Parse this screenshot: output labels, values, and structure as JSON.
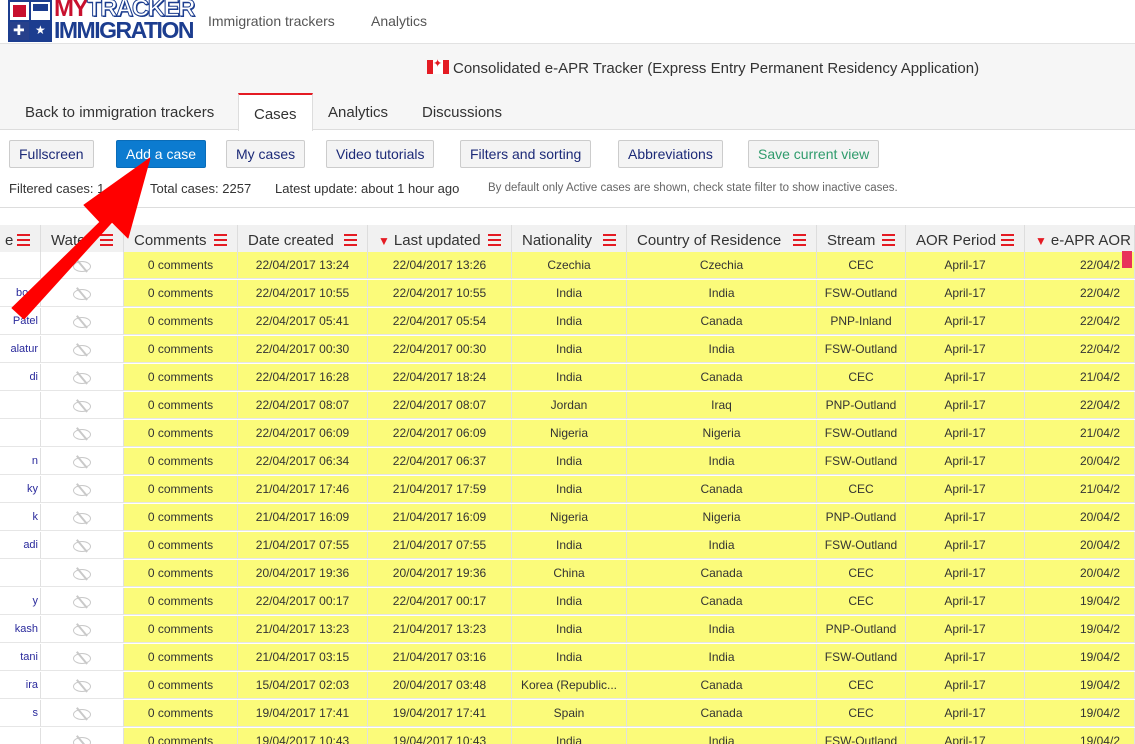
{
  "logo": {
    "line1a": "MY",
    "line1b": "TRACKER",
    "line2": "IMMIGRATION"
  },
  "topnav": {
    "link1": "Immigration trackers",
    "link2": "Analytics"
  },
  "tracker_title": "Consolidated e-APR Tracker (Express Entry Permanent Residency Application)",
  "tabs": [
    "Back to immigration trackers",
    "Cases",
    "Analytics",
    "Discussions"
  ],
  "toolbar": {
    "fullscreen": "Fullscreen",
    "add_case": "Add a case",
    "my_cases": "My cases",
    "video_tutorials": "Video tutorials",
    "filters": "Filters and sorting",
    "abbreviations": "Abbreviations",
    "save_view": "Save current view"
  },
  "stats": {
    "filtered": "Filtered cases: 1",
    "total": "Total cases: 2257",
    "updated": "Latest update: about 1 hour ago",
    "note": "By default only Active cases are shown, check state filter to show inactive cases."
  },
  "colors": {
    "accent": "#e41b23",
    "primary_button": "#0c7bd0",
    "row_highlight": "#fbfb7a"
  },
  "table": {
    "headers": [
      "e",
      "Wate",
      "Comments",
      "Date created",
      "Last updated",
      "Nationality",
      "Country of Residence",
      "Stream",
      "AOR Period",
      "e-APR AOR"
    ],
    "rows": [
      {
        "name": "",
        "comments": "0 comments",
        "created": "22/04/2017 13:24",
        "updated": "22/04/2017 13:26",
        "nationality": "Czechia",
        "residence": "Czechia",
        "stream": "CEC",
        "aor_period": "April-17",
        "aor": "22/04/2"
      },
      {
        "name": "boor",
        "comments": "0 comments",
        "created": "22/04/2017 10:55",
        "updated": "22/04/2017 10:55",
        "nationality": "India",
        "residence": "India",
        "stream": "FSW-Outland",
        "aor_period": "April-17",
        "aor": "22/04/2"
      },
      {
        "name": "Patel",
        "comments": "0 comments",
        "created": "22/04/2017 05:41",
        "updated": "22/04/2017 05:54",
        "nationality": "India",
        "residence": "Canada",
        "stream": "PNP-Inland",
        "aor_period": "April-17",
        "aor": "22/04/2"
      },
      {
        "name": "alatur",
        "comments": "0 comments",
        "created": "22/04/2017 00:30",
        "updated": "22/04/2017 00:30",
        "nationality": "India",
        "residence": "India",
        "stream": "FSW-Outland",
        "aor_period": "April-17",
        "aor": "22/04/2"
      },
      {
        "name": "di",
        "comments": "0 comments",
        "created": "22/04/2017 16:28",
        "updated": "22/04/2017 18:24",
        "nationality": "India",
        "residence": "Canada",
        "stream": "CEC",
        "aor_period": "April-17",
        "aor": "21/04/2"
      },
      {
        "name": "",
        "comments": "0 comments",
        "created": "22/04/2017 08:07",
        "updated": "22/04/2017 08:07",
        "nationality": "Jordan",
        "residence": "Iraq",
        "stream": "PNP-Outland",
        "aor_period": "April-17",
        "aor": "22/04/2"
      },
      {
        "name": "",
        "comments": "0 comments",
        "created": "22/04/2017 06:09",
        "updated": "22/04/2017 06:09",
        "nationality": "Nigeria",
        "residence": "Nigeria",
        "stream": "FSW-Outland",
        "aor_period": "April-17",
        "aor": "21/04/2"
      },
      {
        "name": "n",
        "comments": "0 comments",
        "created": "22/04/2017 06:34",
        "updated": "22/04/2017 06:37",
        "nationality": "India",
        "residence": "India",
        "stream": "FSW-Outland",
        "aor_period": "April-17",
        "aor": "20/04/2"
      },
      {
        "name": "ky",
        "comments": "0 comments",
        "created": "21/04/2017 17:46",
        "updated": "21/04/2017 17:59",
        "nationality": "India",
        "residence": "Canada",
        "stream": "CEC",
        "aor_period": "April-17",
        "aor": "21/04/2"
      },
      {
        "name": "k",
        "comments": "0 comments",
        "created": "21/04/2017 16:09",
        "updated": "21/04/2017 16:09",
        "nationality": "Nigeria",
        "residence": "Nigeria",
        "stream": "PNP-Outland",
        "aor_period": "April-17",
        "aor": "20/04/2"
      },
      {
        "name": "adi",
        "comments": "0 comments",
        "created": "21/04/2017 07:55",
        "updated": "21/04/2017 07:55",
        "nationality": "India",
        "residence": "India",
        "stream": "FSW-Outland",
        "aor_period": "April-17",
        "aor": "20/04/2"
      },
      {
        "name": "",
        "comments": "0 comments",
        "created": "20/04/2017 19:36",
        "updated": "20/04/2017 19:36",
        "nationality": "China",
        "residence": "Canada",
        "stream": "CEC",
        "aor_period": "April-17",
        "aor": "20/04/2"
      },
      {
        "name": "y",
        "comments": "0 comments",
        "created": "22/04/2017 00:17",
        "updated": "22/04/2017 00:17",
        "nationality": "India",
        "residence": "Canada",
        "stream": "CEC",
        "aor_period": "April-17",
        "aor": "19/04/2"
      },
      {
        "name": "kash",
        "comments": "0 comments",
        "created": "21/04/2017 13:23",
        "updated": "21/04/2017 13:23",
        "nationality": "India",
        "residence": "India",
        "stream": "PNP-Outland",
        "aor_period": "April-17",
        "aor": "19/04/2"
      },
      {
        "name": "tani",
        "comments": "0 comments",
        "created": "21/04/2017 03:15",
        "updated": "21/04/2017 03:16",
        "nationality": "India",
        "residence": "India",
        "stream": "FSW-Outland",
        "aor_period": "April-17",
        "aor": "19/04/2"
      },
      {
        "name": "ira",
        "comments": "0 comments",
        "created": "15/04/2017 02:03",
        "updated": "20/04/2017 03:48",
        "nationality": "Korea (Republic...",
        "residence": "Canada",
        "stream": "CEC",
        "aor_period": "April-17",
        "aor": "19/04/2"
      },
      {
        "name": "s",
        "comments": "0 comments",
        "created": "19/04/2017 17:41",
        "updated": "19/04/2017 17:41",
        "nationality": "Spain",
        "residence": "Canada",
        "stream": "CEC",
        "aor_period": "April-17",
        "aor": "19/04/2"
      },
      {
        "name": "",
        "comments": "0 comments",
        "created": "19/04/2017 10:43",
        "updated": "19/04/2017 10:43",
        "nationality": "India",
        "residence": "India",
        "stream": "FSW-Outland",
        "aor_period": "April-17",
        "aor": "19/04/2"
      }
    ]
  }
}
